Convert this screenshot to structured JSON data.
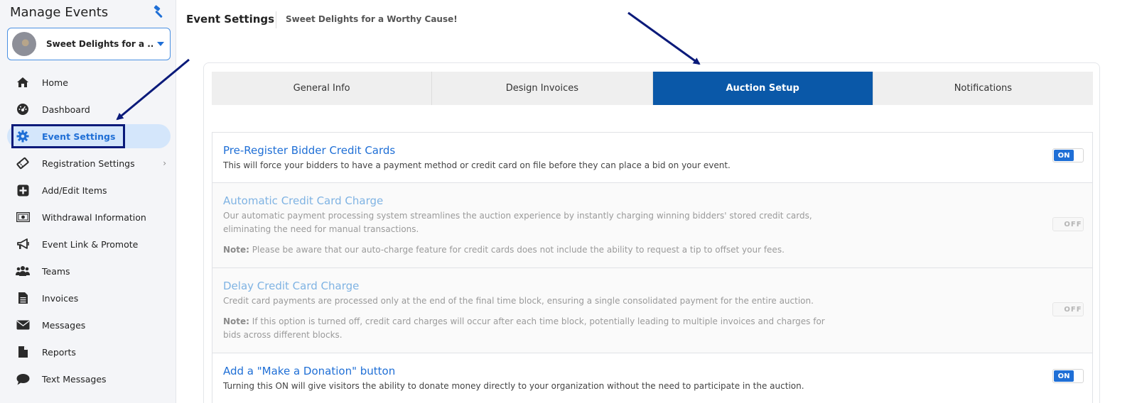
{
  "sidebar": {
    "title": "Manage Events",
    "event_name": "Sweet Delights for a ...",
    "items": [
      {
        "label": "Home",
        "icon": "home-icon"
      },
      {
        "label": "Dashboard",
        "icon": "dashboard-icon"
      },
      {
        "label": "Event Settings",
        "icon": "gear-icon",
        "active": true
      },
      {
        "label": "Registration Settings",
        "icon": "ticket-icon",
        "has_submenu": true
      },
      {
        "label": "Add/Edit Items",
        "icon": "plus-square-icon"
      },
      {
        "label": "Withdrawal Information",
        "icon": "money-icon"
      },
      {
        "label": "Event Link & Promote",
        "icon": "megaphone-icon"
      },
      {
        "label": "Teams",
        "icon": "users-icon"
      },
      {
        "label": "Invoices",
        "icon": "invoice-icon"
      },
      {
        "label": "Messages",
        "icon": "envelope-icon"
      },
      {
        "label": "Reports",
        "icon": "file-icon"
      },
      {
        "label": "Text Messages",
        "icon": "chat-icon"
      }
    ]
  },
  "header": {
    "title": "Event Settings",
    "subtitle": "Sweet Delights for a Worthy Cause!"
  },
  "tabs": [
    {
      "label": "General Info"
    },
    {
      "label": "Design Invoices"
    },
    {
      "label": "Auction Setup",
      "active": true
    },
    {
      "label": "Notifications"
    }
  ],
  "settings": [
    {
      "title": "Pre-Register Bidder Credit Cards",
      "description": "This will force your bidders to have a payment method or credit card on file before they can place a bid on your event.",
      "toggle": "ON"
    },
    {
      "title": "Automatic Credit Card Charge",
      "description": "Our automatic payment processing system streamlines the auction experience by instantly charging winning bidders' stored credit cards, eliminating the need for manual transactions.",
      "note_label": "Note:",
      "note": " Please be aware that our auto-charge feature for credit cards does not include the ability to request a tip to offset your fees.",
      "toggle": "OFF"
    },
    {
      "title": "Delay Credit Card Charge",
      "description": "Credit card payments are processed only at the end of the final time block, ensuring a single consolidated payment for the entire auction.",
      "note_label": "Note:",
      "note": " If this option is turned off, credit card charges will occur after each time block, potentially leading to multiple invoices and charges for bids across different blocks.",
      "toggle": "OFF"
    },
    {
      "title": "Add a \"Make a Donation\" button",
      "description": "Turning this ON will give visitors the ability to donate money directly to your organization without the need to participate in the auction.",
      "toggle": "ON"
    }
  ],
  "colors": {
    "accent": "#1f6fd6",
    "active_tab": "#0a58a8",
    "annotation": "#0a1a7a"
  }
}
